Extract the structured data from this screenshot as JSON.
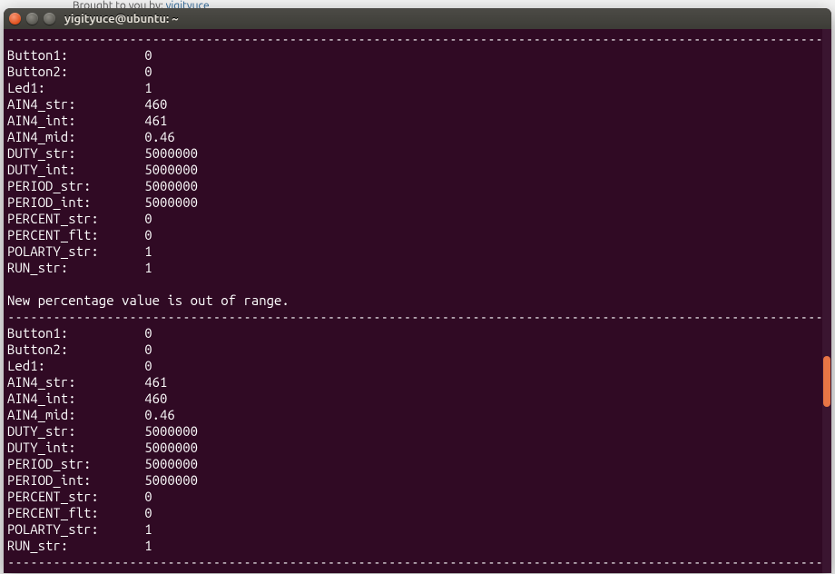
{
  "background": {
    "text_prefix": "Brought to you by: ",
    "link_text": "yigityuce"
  },
  "window": {
    "title": "yigityuce@ubuntu: ~"
  },
  "divider": "-------------------------------------------------------------------------------------------------------------",
  "block1": {
    "rows": [
      {
        "label": "Button1:",
        "value": "0"
      },
      {
        "label": "Button2:",
        "value": "0"
      },
      {
        "label": "Led1:",
        "value": "1"
      },
      {
        "label": "AIN4_str:",
        "value": "460"
      },
      {
        "label": "AIN4_int:",
        "value": "461"
      },
      {
        "label": "AIN4_mid:",
        "value": "0.46"
      },
      {
        "label": "DUTY_str:",
        "value": "5000000"
      },
      {
        "label": "DUTY_int:",
        "value": "5000000"
      },
      {
        "label": "PERIOD_str:",
        "value": "5000000"
      },
      {
        "label": "PERIOD_int:",
        "value": "5000000"
      },
      {
        "label": "PERCENT_str:",
        "value": "0"
      },
      {
        "label": "PERCENT_flt:",
        "value": "0"
      },
      {
        "label": "POLARTY_str:",
        "value": "1"
      },
      {
        "label": "RUN_str:",
        "value": "1"
      }
    ]
  },
  "message": "New percentage value is out of range.",
  "block2": {
    "rows": [
      {
        "label": "Button1:",
        "value": "0"
      },
      {
        "label": "Button2:",
        "value": "0"
      },
      {
        "label": "Led1:",
        "value": "0"
      },
      {
        "label": "AIN4_str:",
        "value": "461"
      },
      {
        "label": "AIN4_int:",
        "value": "460"
      },
      {
        "label": "AIN4_mid:",
        "value": "0.46"
      },
      {
        "label": "DUTY_str:",
        "value": "5000000"
      },
      {
        "label": "DUTY_int:",
        "value": "5000000"
      },
      {
        "label": "PERIOD_str:",
        "value": "5000000"
      },
      {
        "label": "PERIOD_int:",
        "value": "5000000"
      },
      {
        "label": "PERCENT_str:",
        "value": "0"
      },
      {
        "label": "PERCENT_flt:",
        "value": "0"
      },
      {
        "label": "POLARTY_str:",
        "value": "1"
      },
      {
        "label": "RUN_str:",
        "value": "1"
      }
    ]
  }
}
